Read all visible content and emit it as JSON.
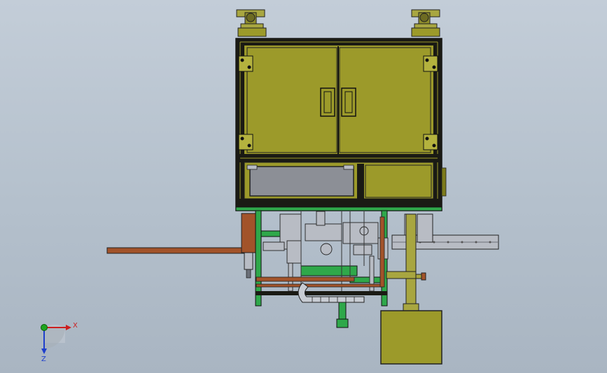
{
  "viewport": {
    "view": "front",
    "background": "#b9c4cf"
  },
  "triad": {
    "x_label": "X",
    "z_label": "Z",
    "x_color": "#cc1f1f",
    "y_color": "#1fa51f",
    "z_color": "#1f3fcc"
  },
  "colors": {
    "cabinet": "#9c9a2a",
    "cabinet_dark": "#7d7b1c",
    "frame_black": "#1a1a14",
    "green_frame": "#2fa84a",
    "rust_bar": "#a2532a",
    "steel": "#b8bcc4",
    "window": "#8c8f96"
  }
}
